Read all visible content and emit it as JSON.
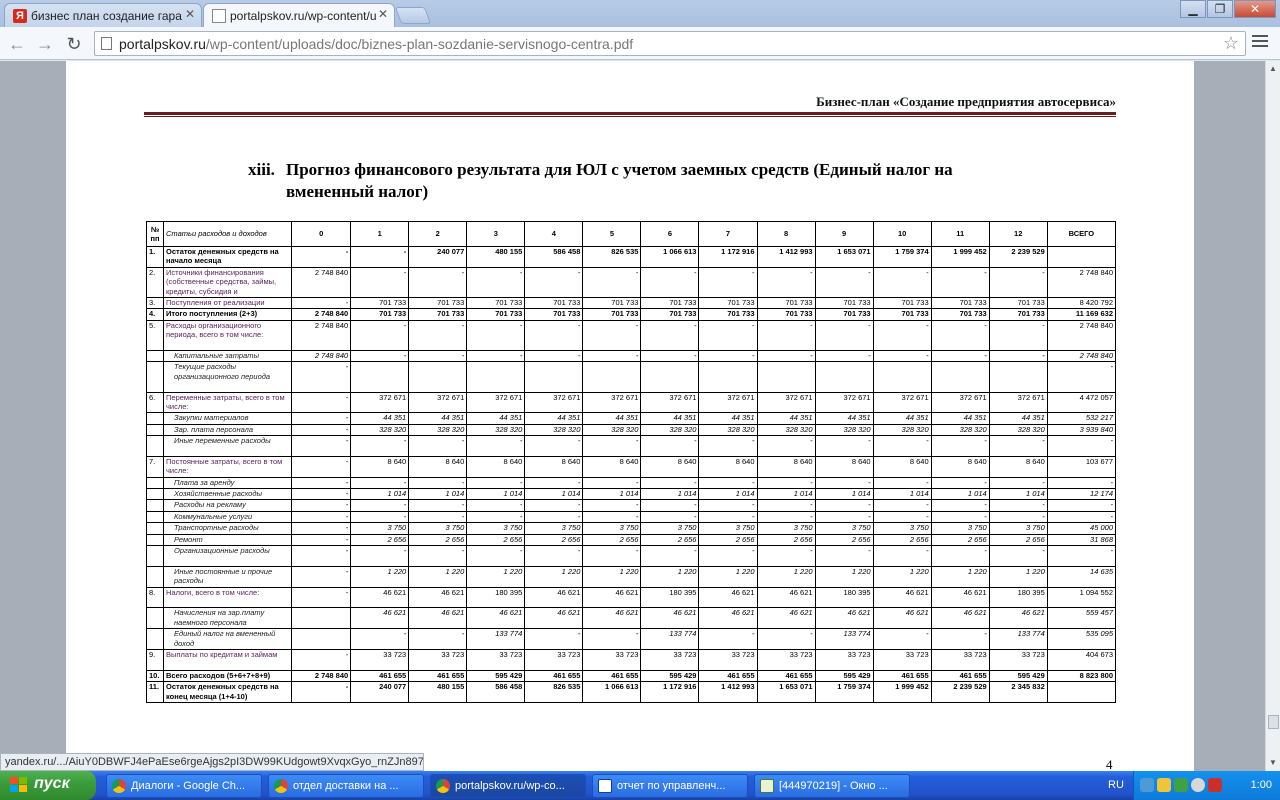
{
  "browser": {
    "tabs": [
      {
        "label": "бизнес план создание гара",
        "favicon": "yandex-icon",
        "active": false
      },
      {
        "label": "portalpskov.ru/wp-content/u",
        "favicon": "page-icon",
        "active": true
      }
    ],
    "url_domain": "portalpskov.ru",
    "url_path": "/wp-content/uploads/doc/biznes-plan-sozdanie-servisnogo-centra.pdf",
    "status_url": "yandex.ru/.../AiuY0DBWFJ4ePaEse6rgeAjgs2pI3DW99KUdgowt9XvqxGyo_rnZJn897..."
  },
  "document": {
    "header": "Бизнес-план «Создание предприятия автосервиса»",
    "title_num": "xiii.",
    "title_line1": "Прогноз финансового результата для ЮЛ с учетом заемных средств (Единый налог на",
    "title_line2": "вмененный налог)",
    "page_number": "4",
    "table": {
      "headers": [
        "№ пп",
        "Статьи расходов и доходов",
        "0",
        "1",
        "2",
        "3",
        "4",
        "5",
        "6",
        "7",
        "8",
        "9",
        "10",
        "11",
        "12",
        "ВСЕГО"
      ],
      "rows": [
        {
          "n": "1.",
          "item": "Остаток денежных средств на начало месяца",
          "bold": true,
          "sub": false,
          "h": 2,
          "v": [
            "-",
            "-",
            "240 077",
            "480 155",
            "586 458",
            "826 535",
            "1 066 613",
            "1 172 916",
            "1 412 993",
            "1 653 071",
            "1 759 374",
            "1 999 452",
            "2 239 529",
            ""
          ]
        },
        {
          "n": "2.",
          "item": "Источники финансирования (собственные средства, займы, кредиты, субсидия и",
          "bold": false,
          "sub": false,
          "h": 3,
          "v": [
            "2 748 840",
            "-",
            "-",
            "-",
            "-",
            "-",
            "-",
            "-",
            "-",
            "-",
            "-",
            "-",
            "-",
            "2 748 840"
          ]
        },
        {
          "n": "3.",
          "item": "Поступления от реализации",
          "bold": false,
          "sub": false,
          "h": 1,
          "v": [
            "-",
            "701 733",
            "701 733",
            "701 733",
            "701 733",
            "701 733",
            "701 733",
            "701 733",
            "701 733",
            "701 733",
            "701 733",
            "701 733",
            "701 733",
            "8 420 792"
          ]
        },
        {
          "n": "4.",
          "item": "Итого поступления (2+3)",
          "bold": true,
          "sub": false,
          "h": 1,
          "v": [
            "2 748 840",
            "701 733",
            "701 733",
            "701 733",
            "701 733",
            "701 733",
            "701 733",
            "701 733",
            "701 733",
            "701 733",
            "701 733",
            "701 733",
            "701 733",
            "11 169 632"
          ]
        },
        {
          "n": "5.",
          "item": "Расходы организационного периода, всего в том числе:",
          "bold": false,
          "sub": false,
          "h": 3,
          "v": [
            "2 748 840",
            "-",
            "-",
            "-",
            "-",
            "-",
            "-",
            "-",
            "-",
            "-",
            "-",
            "-",
            "-",
            "2 748 840"
          ]
        },
        {
          "n": "",
          "item": "Капитальные затраты",
          "bold": false,
          "sub": true,
          "h": 1,
          "v": [
            "2 748 840",
            "-",
            "-",
            "-",
            "-",
            "-",
            "-",
            "-",
            "-",
            "-",
            "-",
            "-",
            "-",
            "2 748 840"
          ]
        },
        {
          "n": "",
          "item": "Текущие расходы организационного периода",
          "bold": false,
          "sub": true,
          "h": 3,
          "v": [
            "-",
            "",
            "",
            "",
            "",
            "",
            "",
            "",
            "",
            "",
            "",
            "",
            "",
            "-"
          ]
        },
        {
          "n": "6.",
          "item": "Переменные затраты, всего в том числе:",
          "bold": false,
          "sub": false,
          "h": 2,
          "v": [
            "-",
            "372 671",
            "372 671",
            "372 671",
            "372 671",
            "372 671",
            "372 671",
            "372 671",
            "372 671",
            "372 671",
            "372 671",
            "372 671",
            "372 671",
            "4 472 057"
          ]
        },
        {
          "n": "",
          "item": "Закупки материалов",
          "bold": false,
          "sub": true,
          "h": 1,
          "v": [
            "-",
            "44 351",
            "44 351",
            "44 351",
            "44 351",
            "44 351",
            "44 351",
            "44 351",
            "44 351",
            "44 351",
            "44 351",
            "44 351",
            "44 351",
            "532 217"
          ]
        },
        {
          "n": "",
          "item": "Зар. плата персонала",
          "bold": false,
          "sub": true,
          "h": 1,
          "v": [
            "-",
            "328 320",
            "328 320",
            "328 320",
            "328 320",
            "328 320",
            "328 320",
            "328 320",
            "328 320",
            "328 320",
            "328 320",
            "328 320",
            "328 320",
            "3 939 840"
          ]
        },
        {
          "n": "",
          "item": "Иные переменные расходы",
          "bold": false,
          "sub": true,
          "h": 2,
          "v": [
            "-",
            "-",
            "-",
            "-",
            "-",
            "-",
            "-",
            "-",
            "-",
            "-",
            "-",
            "-",
            "-",
            "-"
          ]
        },
        {
          "n": "7.",
          "item": "Постоянные затраты, всего в том числе:",
          "bold": false,
          "sub": false,
          "h": 2,
          "v": [
            "-",
            "8 640",
            "8 640",
            "8 640",
            "8 640",
            "8 640",
            "8 640",
            "8 640",
            "8 640",
            "8 640",
            "8 640",
            "8 640",
            "8 640",
            "103 677"
          ]
        },
        {
          "n": "",
          "item": "Плата за аренду",
          "bold": false,
          "sub": true,
          "h": 1,
          "v": [
            "-",
            "-",
            "-",
            "-",
            "-",
            "-",
            "-",
            "-",
            "-",
            "-",
            "-",
            "-",
            "-",
            "-"
          ]
        },
        {
          "n": "",
          "item": "Хозяйственные расходы",
          "bold": false,
          "sub": true,
          "h": 1,
          "v": [
            "-",
            "1 014",
            "1 014",
            "1 014",
            "1 014",
            "1 014",
            "1 014",
            "1 014",
            "1 014",
            "1 014",
            "1 014",
            "1 014",
            "1 014",
            "12 174"
          ]
        },
        {
          "n": "",
          "item": "Расходы на рекламу",
          "bold": false,
          "sub": true,
          "h": 1,
          "v": [
            "-",
            "-",
            "-",
            "-",
            "-",
            "-",
            "-",
            "-",
            "-",
            "-",
            "-",
            "-",
            "-",
            "-"
          ]
        },
        {
          "n": "",
          "item": "Коммунальные услуги",
          "bold": false,
          "sub": true,
          "h": 1,
          "v": [
            "-",
            "-",
            "-",
            "-",
            "-",
            "-",
            "-",
            "-",
            "-",
            "-",
            "-",
            "-",
            "-",
            "-"
          ]
        },
        {
          "n": "",
          "item": "Транспортные расходы",
          "bold": false,
          "sub": true,
          "h": 1,
          "v": [
            "-",
            "3 750",
            "3 750",
            "3 750",
            "3 750",
            "3 750",
            "3 750",
            "3 750",
            "3 750",
            "3 750",
            "3 750",
            "3 750",
            "3 750",
            "45 000"
          ]
        },
        {
          "n": "",
          "item": "Ремонт",
          "bold": false,
          "sub": true,
          "h": 1,
          "v": [
            "-",
            "2 656",
            "2 656",
            "2 656",
            "2 656",
            "2 656",
            "2 656",
            "2 656",
            "2 656",
            "2 656",
            "2 656",
            "2 656",
            "2 656",
            "31 868"
          ]
        },
        {
          "n": "",
          "item": "Организационные расходы",
          "bold": false,
          "sub": true,
          "h": 2,
          "v": [
            "-",
            "-",
            "-",
            "-",
            "-",
            "-",
            "-",
            "-",
            "-",
            "-",
            "-",
            "-",
            "-",
            "-"
          ]
        },
        {
          "n": "",
          "item": "Иные постоянные и прочие расходы",
          "bold": false,
          "sub": true,
          "h": 2,
          "v": [
            "-",
            "1 220",
            "1 220",
            "1 220",
            "1 220",
            "1 220",
            "1 220",
            "1 220",
            "1 220",
            "1 220",
            "1 220",
            "1 220",
            "1 220",
            "14 635"
          ]
        },
        {
          "n": "8.",
          "item": "Налоги, всего в том числе:",
          "bold": false,
          "sub": false,
          "h": 2,
          "v": [
            "-",
            "46 621",
            "46 621",
            "180 395",
            "46 621",
            "46 621",
            "180 395",
            "46 621",
            "46 621",
            "180 395",
            "46 621",
            "46 621",
            "180 395",
            "1 094 552"
          ]
        },
        {
          "n": "",
          "item": "Начисления на зар.плату наемного персонала",
          "bold": false,
          "sub": true,
          "h": 2,
          "v": [
            "",
            "46 621",
            "46 621",
            "46 621",
            "46 621",
            "46 621",
            "46 621",
            "46 621",
            "46 621",
            "46 621",
            "46 621",
            "46 621",
            "46 621",
            "559 457"
          ]
        },
        {
          "n": "",
          "item": "Единый налог на вмененный доход",
          "bold": false,
          "sub": true,
          "h": 2,
          "v": [
            "",
            "-",
            "-",
            "133 774",
            "-",
            "-",
            "133 774",
            "-",
            "-",
            "133 774",
            "-",
            "-",
            "133 774",
            "535 095"
          ]
        },
        {
          "n": "9.",
          "item": "Выплаты по кредитам и займам",
          "bold": false,
          "sub": false,
          "h": 2,
          "v": [
            "-",
            "33 723",
            "33 723",
            "33 723",
            "33 723",
            "33 723",
            "33 723",
            "33 723",
            "33 723",
            "33 723",
            "33 723",
            "33 723",
            "33 723",
            "404 673"
          ]
        },
        {
          "n": "10.",
          "item": "Всего расходов (5+6+7+8+9)",
          "bold": true,
          "sub": false,
          "h": 1,
          "v": [
            "2 748 840",
            "461 655",
            "461 655",
            "595 429",
            "461 655",
            "461 655",
            "595 429",
            "461 655",
            "461 655",
            "595 429",
            "461 655",
            "461 655",
            "595 429",
            "8 823 800"
          ]
        },
        {
          "n": "11.",
          "item": "Остаток денежных средств на конец месяца (1+4-10)",
          "bold": true,
          "sub": false,
          "h": 2,
          "v": [
            "-",
            "240 077",
            "480 155",
            "586 458",
            "826 535",
            "1 066 613",
            "1 172 916",
            "1 412 993",
            "1 653 071",
            "1 759 374",
            "1 999 452",
            "2 239 529",
            "2 345 832",
            ""
          ]
        }
      ]
    }
  },
  "taskbar": {
    "start_label": "пуск",
    "tasks": [
      {
        "label": "Диалоги - Google Ch...",
        "icon": "chrome-icon",
        "active": false
      },
      {
        "label": "отдел доставки на ...",
        "icon": "chrome-icon",
        "active": false
      },
      {
        "label": "portalpskov.ru/wp-co...",
        "icon": "chrome-icon",
        "active": true
      },
      {
        "label": "отчет по управленч...",
        "icon": "word-icon",
        "active": false
      },
      {
        "label": "[444970219] - Окно ...",
        "icon": "window-icon",
        "active": false
      }
    ],
    "lang": "RU",
    "clock": "1:00"
  }
}
